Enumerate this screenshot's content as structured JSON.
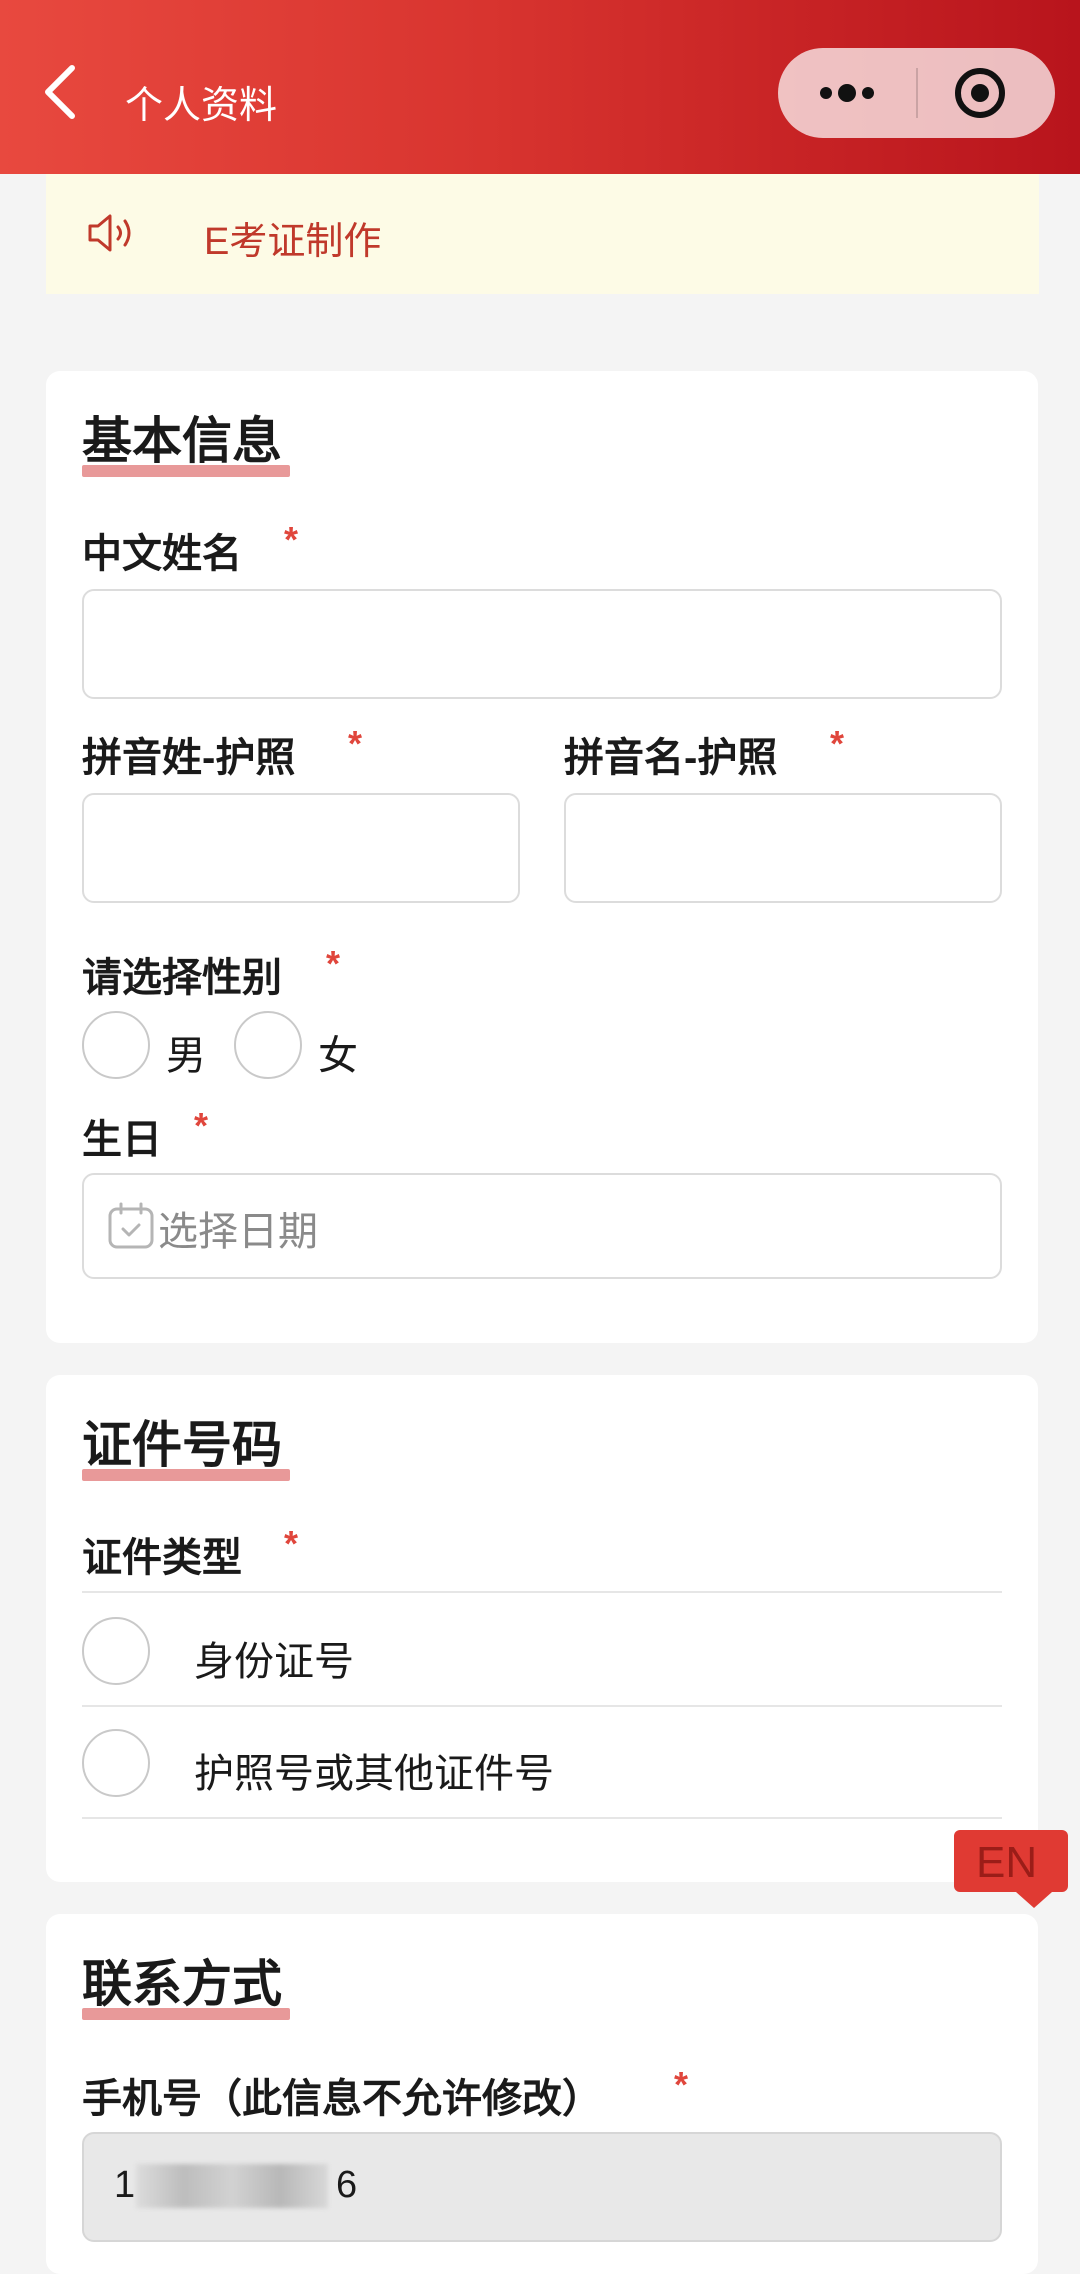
{
  "header": {
    "title": "个人资料"
  },
  "notice": {
    "text": "E考证制作"
  },
  "basic_info": {
    "section_title": "基本信息",
    "chinese_name": {
      "label": "中文姓名",
      "required": "*",
      "value": ""
    },
    "pinyin_surname": {
      "label": "拼音姓-护照",
      "required": "*",
      "value": ""
    },
    "pinyin_given": {
      "label": "拼音名-护照",
      "required": "*",
      "value": ""
    },
    "gender": {
      "label": "请选择性别",
      "required": "*",
      "options": [
        "男",
        "女"
      ]
    },
    "birthday": {
      "label": "生日",
      "required": "*",
      "placeholder": "选择日期"
    }
  },
  "id_section": {
    "section_title": "证件号码",
    "id_type": {
      "label": "证件类型",
      "required": "*",
      "options": [
        "身份证号",
        "护照号或其他证件号"
      ]
    }
  },
  "contact_section": {
    "section_title": "联系方式",
    "phone": {
      "label": "手机号（此信息不允许修改）",
      "required": "*",
      "value_start": "1",
      "value_end": "6"
    }
  },
  "language_badge": {
    "label": "EN"
  },
  "colors": {
    "brand_red": "#d8342f",
    "required_star": "#e0463c",
    "underline": "#e89999",
    "notice_bg": "#fdfbe6"
  }
}
